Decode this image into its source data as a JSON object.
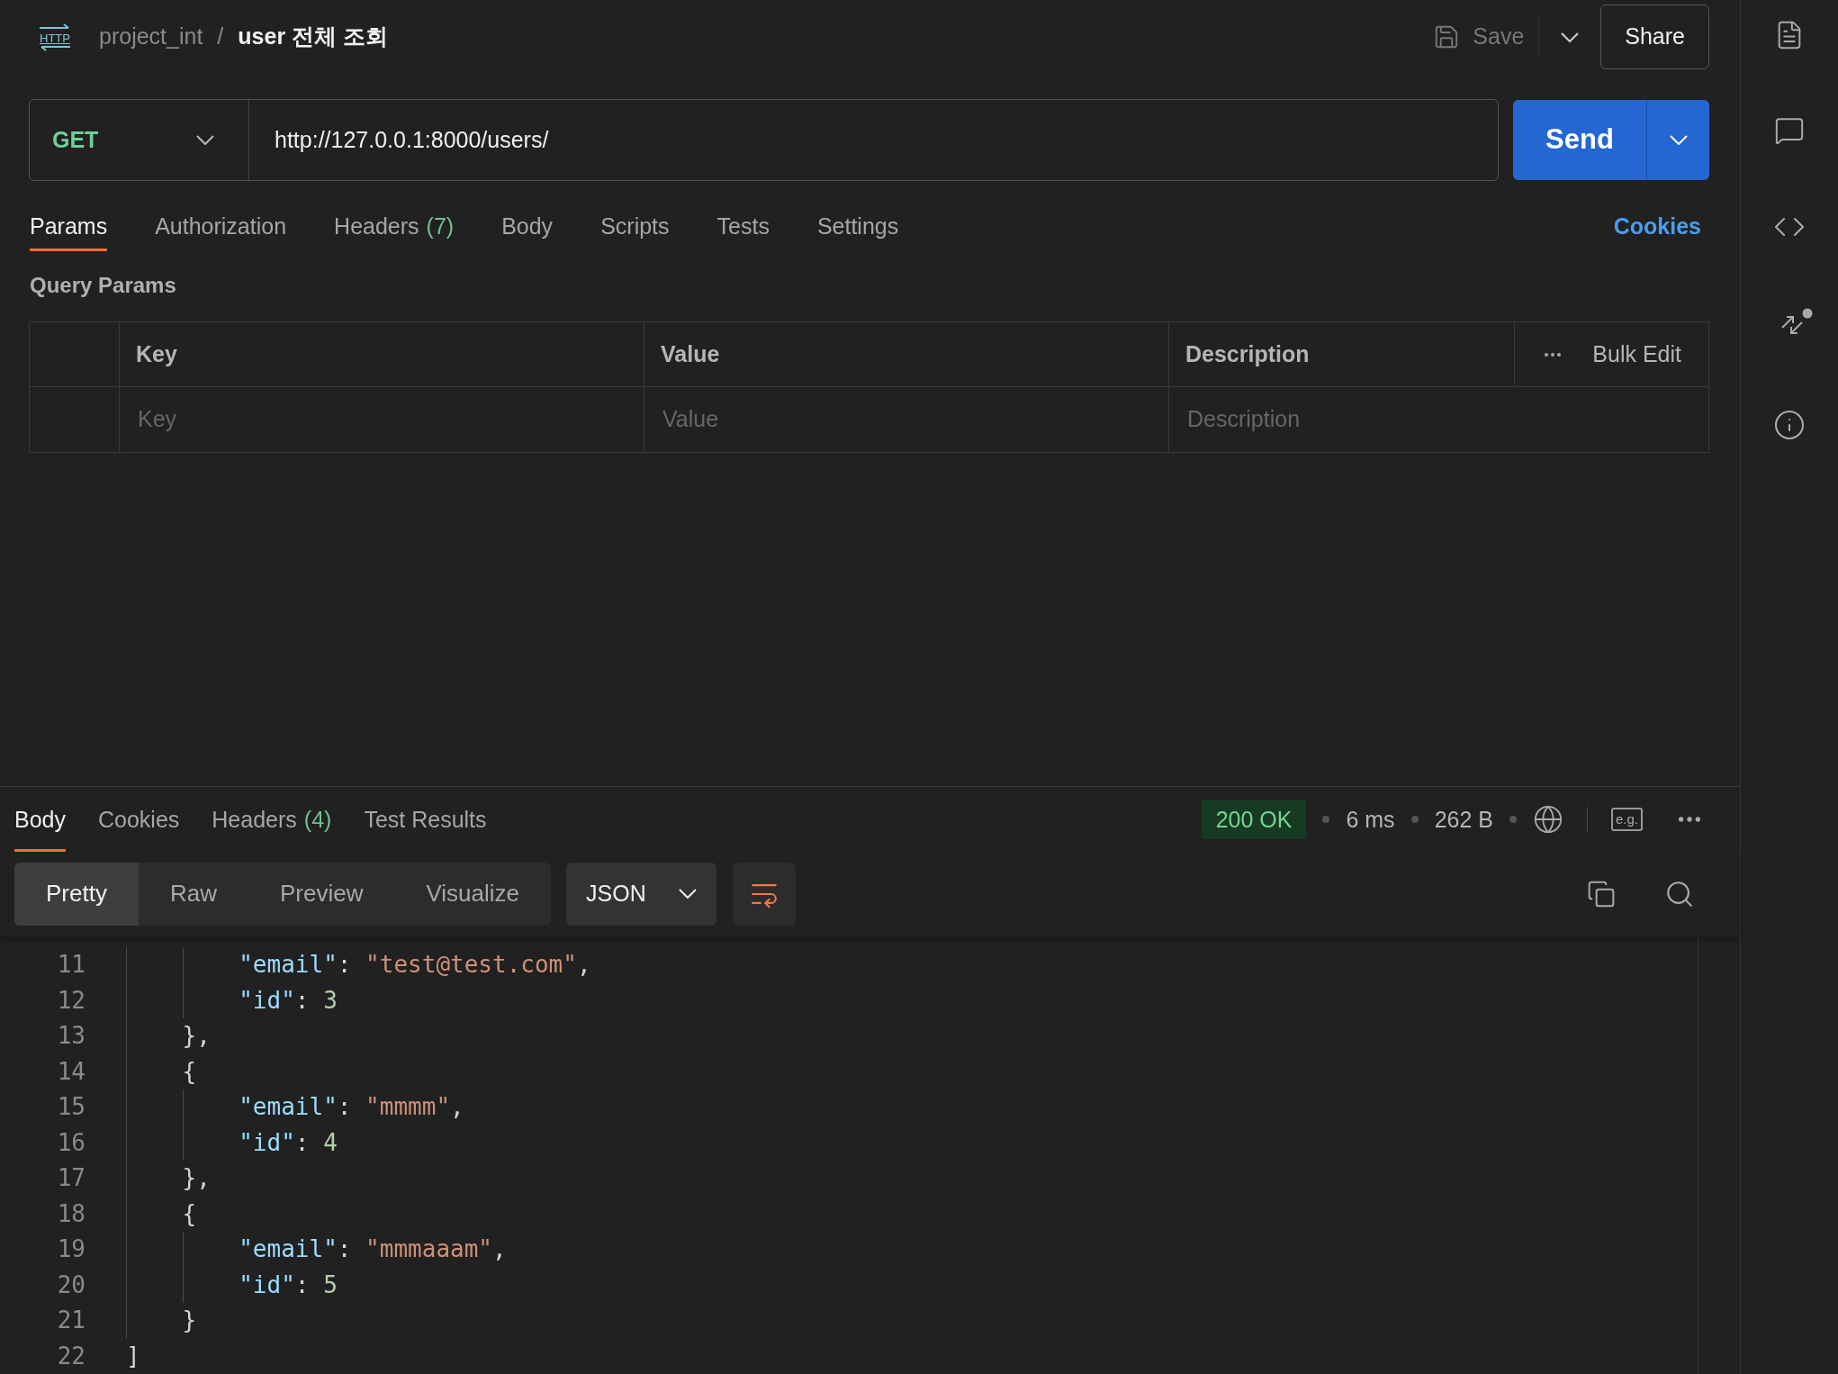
{
  "breadcrumb": {
    "request_type": "HTTP",
    "collection": "project_int",
    "separator": "/",
    "request_name": "user 전체 조회"
  },
  "header_actions": {
    "save": {
      "label": "Save",
      "disabled": true
    },
    "share": "Share"
  },
  "request": {
    "method": "GET",
    "url": "http://127.0.0.1:8000/users/",
    "send": "Send"
  },
  "request_tabs": [
    {
      "label": "Params",
      "selected": true
    },
    {
      "label": "Authorization",
      "selected": false
    },
    {
      "label": "Headers",
      "count": "(7)",
      "selected": false
    },
    {
      "label": "Body",
      "selected": false
    },
    {
      "label": "Scripts",
      "selected": false
    },
    {
      "label": "Tests",
      "selected": false
    },
    {
      "label": "Settings",
      "selected": false
    }
  ],
  "cookies_link": "Cookies",
  "query_params": {
    "title": "Query Params",
    "columns": [
      "Key",
      "Value",
      "Description"
    ],
    "bulk_edit": "Bulk Edit",
    "row": {
      "key_placeholder": "Key",
      "value_placeholder": "Value",
      "description_placeholder": "Description"
    }
  },
  "response": {
    "tabs": [
      {
        "label": "Body",
        "selected": true
      },
      {
        "label": "Cookies",
        "selected": false
      },
      {
        "label": "Headers",
        "count": "(4)",
        "selected": false
      },
      {
        "label": "Test Results",
        "selected": false
      }
    ],
    "status": "200 OK",
    "time": "6 ms",
    "size": "262 B",
    "examples_label": "e.g.",
    "view_modes": [
      {
        "label": "Pretty",
        "selected": true
      },
      {
        "label": "Raw",
        "selected": false
      },
      {
        "label": "Preview",
        "selected": false
      },
      {
        "label": "Visualize",
        "selected": false
      }
    ],
    "format": "JSON",
    "code_lines": [
      {
        "number": "11",
        "text": "        \"email\": \"test@test.com\","
      },
      {
        "number": "12",
        "text": "        \"id\": 3"
      },
      {
        "number": "13",
        "text": "    },"
      },
      {
        "number": "14",
        "text": "    {"
      },
      {
        "number": "15",
        "text": "        \"email\": \"mmmm\","
      },
      {
        "number": "16",
        "text": "        \"id\": 4"
      },
      {
        "number": "17",
        "text": "    },"
      },
      {
        "number": "18",
        "text": "    {"
      },
      {
        "number": "19",
        "text": "        \"email\": \"mmmaaam\","
      },
      {
        "number": "20",
        "text": "        \"id\": 5"
      },
      {
        "number": "21",
        "text": "    }"
      },
      {
        "number": "22",
        "text": "]"
      }
    ]
  }
}
